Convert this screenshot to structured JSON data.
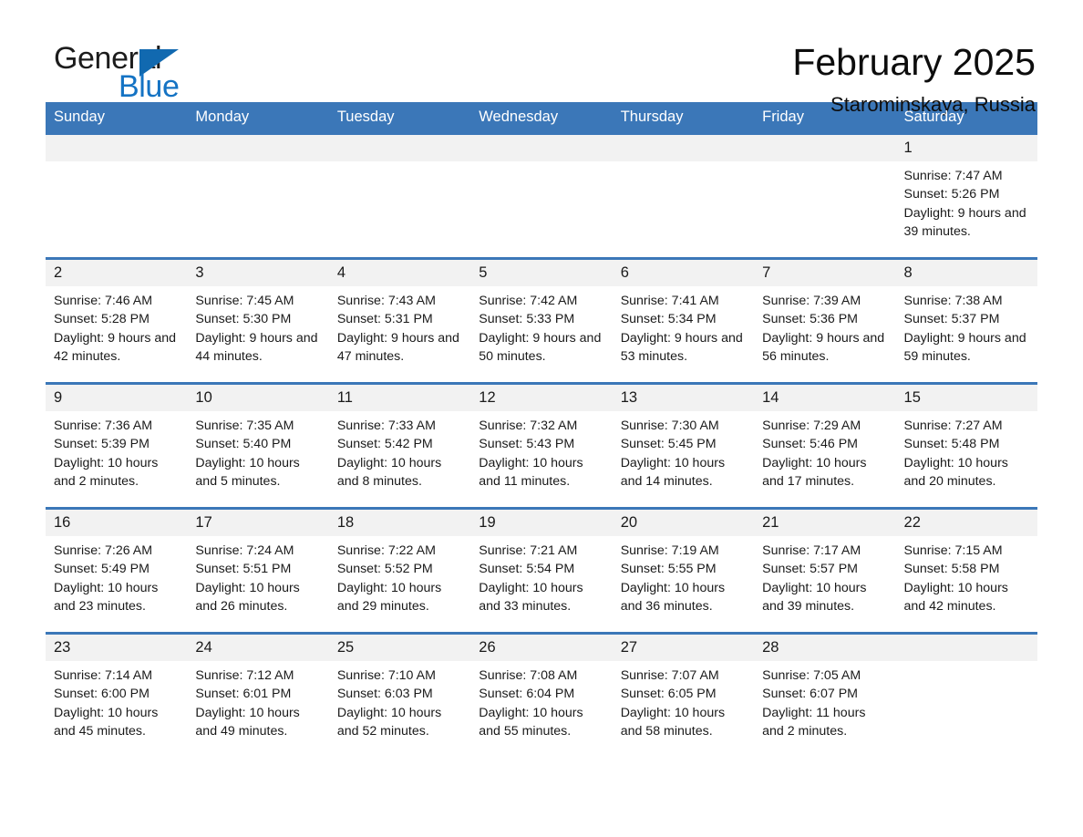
{
  "brand": {
    "word_one": "General",
    "word_two": "Blue",
    "triangle_color": "#1169b0",
    "blue_text_color": "#1473c4"
  },
  "header": {
    "title": "February 2025",
    "subtitle": "Starominskaya, Russia"
  },
  "theme": {
    "header_blue": "#3b77b8",
    "daynum_background": "#f2f2f2",
    "page_background": "#ffffff"
  },
  "calendar": {
    "weekday_headers": [
      "Sunday",
      "Monday",
      "Tuesday",
      "Wednesday",
      "Thursday",
      "Friday",
      "Saturday"
    ],
    "labels": {
      "sunrise_prefix": "Sunrise:",
      "sunset_prefix": "Sunset:",
      "daylight_prefix": "Daylight:"
    },
    "weeks": [
      [
        {
          "day": "",
          "blank": true
        },
        {
          "day": "",
          "blank": true
        },
        {
          "day": "",
          "blank": true
        },
        {
          "day": "",
          "blank": true
        },
        {
          "day": "",
          "blank": true
        },
        {
          "day": "",
          "blank": true
        },
        {
          "day": "1",
          "sunrise": "Sunrise: 7:47 AM",
          "sunset": "Sunset: 5:26 PM",
          "daylight": "Daylight: 9 hours and 39 minutes."
        }
      ],
      [
        {
          "day": "2",
          "sunrise": "Sunrise: 7:46 AM",
          "sunset": "Sunset: 5:28 PM",
          "daylight": "Daylight: 9 hours and 42 minutes."
        },
        {
          "day": "3",
          "sunrise": "Sunrise: 7:45 AM",
          "sunset": "Sunset: 5:30 PM",
          "daylight": "Daylight: 9 hours and 44 minutes."
        },
        {
          "day": "4",
          "sunrise": "Sunrise: 7:43 AM",
          "sunset": "Sunset: 5:31 PM",
          "daylight": "Daylight: 9 hours and 47 minutes."
        },
        {
          "day": "5",
          "sunrise": "Sunrise: 7:42 AM",
          "sunset": "Sunset: 5:33 PM",
          "daylight": "Daylight: 9 hours and 50 minutes."
        },
        {
          "day": "6",
          "sunrise": "Sunrise: 7:41 AM",
          "sunset": "Sunset: 5:34 PM",
          "daylight": "Daylight: 9 hours and 53 minutes."
        },
        {
          "day": "7",
          "sunrise": "Sunrise: 7:39 AM",
          "sunset": "Sunset: 5:36 PM",
          "daylight": "Daylight: 9 hours and 56 minutes."
        },
        {
          "day": "8",
          "sunrise": "Sunrise: 7:38 AM",
          "sunset": "Sunset: 5:37 PM",
          "daylight": "Daylight: 9 hours and 59 minutes."
        }
      ],
      [
        {
          "day": "9",
          "sunrise": "Sunrise: 7:36 AM",
          "sunset": "Sunset: 5:39 PM",
          "daylight": "Daylight: 10 hours and 2 minutes."
        },
        {
          "day": "10",
          "sunrise": "Sunrise: 7:35 AM",
          "sunset": "Sunset: 5:40 PM",
          "daylight": "Daylight: 10 hours and 5 minutes."
        },
        {
          "day": "11",
          "sunrise": "Sunrise: 7:33 AM",
          "sunset": "Sunset: 5:42 PM",
          "daylight": "Daylight: 10 hours and 8 minutes."
        },
        {
          "day": "12",
          "sunrise": "Sunrise: 7:32 AM",
          "sunset": "Sunset: 5:43 PM",
          "daylight": "Daylight: 10 hours and 11 minutes."
        },
        {
          "day": "13",
          "sunrise": "Sunrise: 7:30 AM",
          "sunset": "Sunset: 5:45 PM",
          "daylight": "Daylight: 10 hours and 14 minutes."
        },
        {
          "day": "14",
          "sunrise": "Sunrise: 7:29 AM",
          "sunset": "Sunset: 5:46 PM",
          "daylight": "Daylight: 10 hours and 17 minutes."
        },
        {
          "day": "15",
          "sunrise": "Sunrise: 7:27 AM",
          "sunset": "Sunset: 5:48 PM",
          "daylight": "Daylight: 10 hours and 20 minutes."
        }
      ],
      [
        {
          "day": "16",
          "sunrise": "Sunrise: 7:26 AM",
          "sunset": "Sunset: 5:49 PM",
          "daylight": "Daylight: 10 hours and 23 minutes."
        },
        {
          "day": "17",
          "sunrise": "Sunrise: 7:24 AM",
          "sunset": "Sunset: 5:51 PM",
          "daylight": "Daylight: 10 hours and 26 minutes."
        },
        {
          "day": "18",
          "sunrise": "Sunrise: 7:22 AM",
          "sunset": "Sunset: 5:52 PM",
          "daylight": "Daylight: 10 hours and 29 minutes."
        },
        {
          "day": "19",
          "sunrise": "Sunrise: 7:21 AM",
          "sunset": "Sunset: 5:54 PM",
          "daylight": "Daylight: 10 hours and 33 minutes."
        },
        {
          "day": "20",
          "sunrise": "Sunrise: 7:19 AM",
          "sunset": "Sunset: 5:55 PM",
          "daylight": "Daylight: 10 hours and 36 minutes."
        },
        {
          "day": "21",
          "sunrise": "Sunrise: 7:17 AM",
          "sunset": "Sunset: 5:57 PM",
          "daylight": "Daylight: 10 hours and 39 minutes."
        },
        {
          "day": "22",
          "sunrise": "Sunrise: 7:15 AM",
          "sunset": "Sunset: 5:58 PM",
          "daylight": "Daylight: 10 hours and 42 minutes."
        }
      ],
      [
        {
          "day": "23",
          "sunrise": "Sunrise: 7:14 AM",
          "sunset": "Sunset: 6:00 PM",
          "daylight": "Daylight: 10 hours and 45 minutes."
        },
        {
          "day": "24",
          "sunrise": "Sunrise: 7:12 AM",
          "sunset": "Sunset: 6:01 PM",
          "daylight": "Daylight: 10 hours and 49 minutes."
        },
        {
          "day": "25",
          "sunrise": "Sunrise: 7:10 AM",
          "sunset": "Sunset: 6:03 PM",
          "daylight": "Daylight: 10 hours and 52 minutes."
        },
        {
          "day": "26",
          "sunrise": "Sunrise: 7:08 AM",
          "sunset": "Sunset: 6:04 PM",
          "daylight": "Daylight: 10 hours and 55 minutes."
        },
        {
          "day": "27",
          "sunrise": "Sunrise: 7:07 AM",
          "sunset": "Sunset: 6:05 PM",
          "daylight": "Daylight: 10 hours and 58 minutes."
        },
        {
          "day": "28",
          "sunrise": "Sunrise: 7:05 AM",
          "sunset": "Sunset: 6:07 PM",
          "daylight": "Daylight: 11 hours and 2 minutes."
        },
        {
          "day": "",
          "blank": true
        }
      ]
    ]
  }
}
